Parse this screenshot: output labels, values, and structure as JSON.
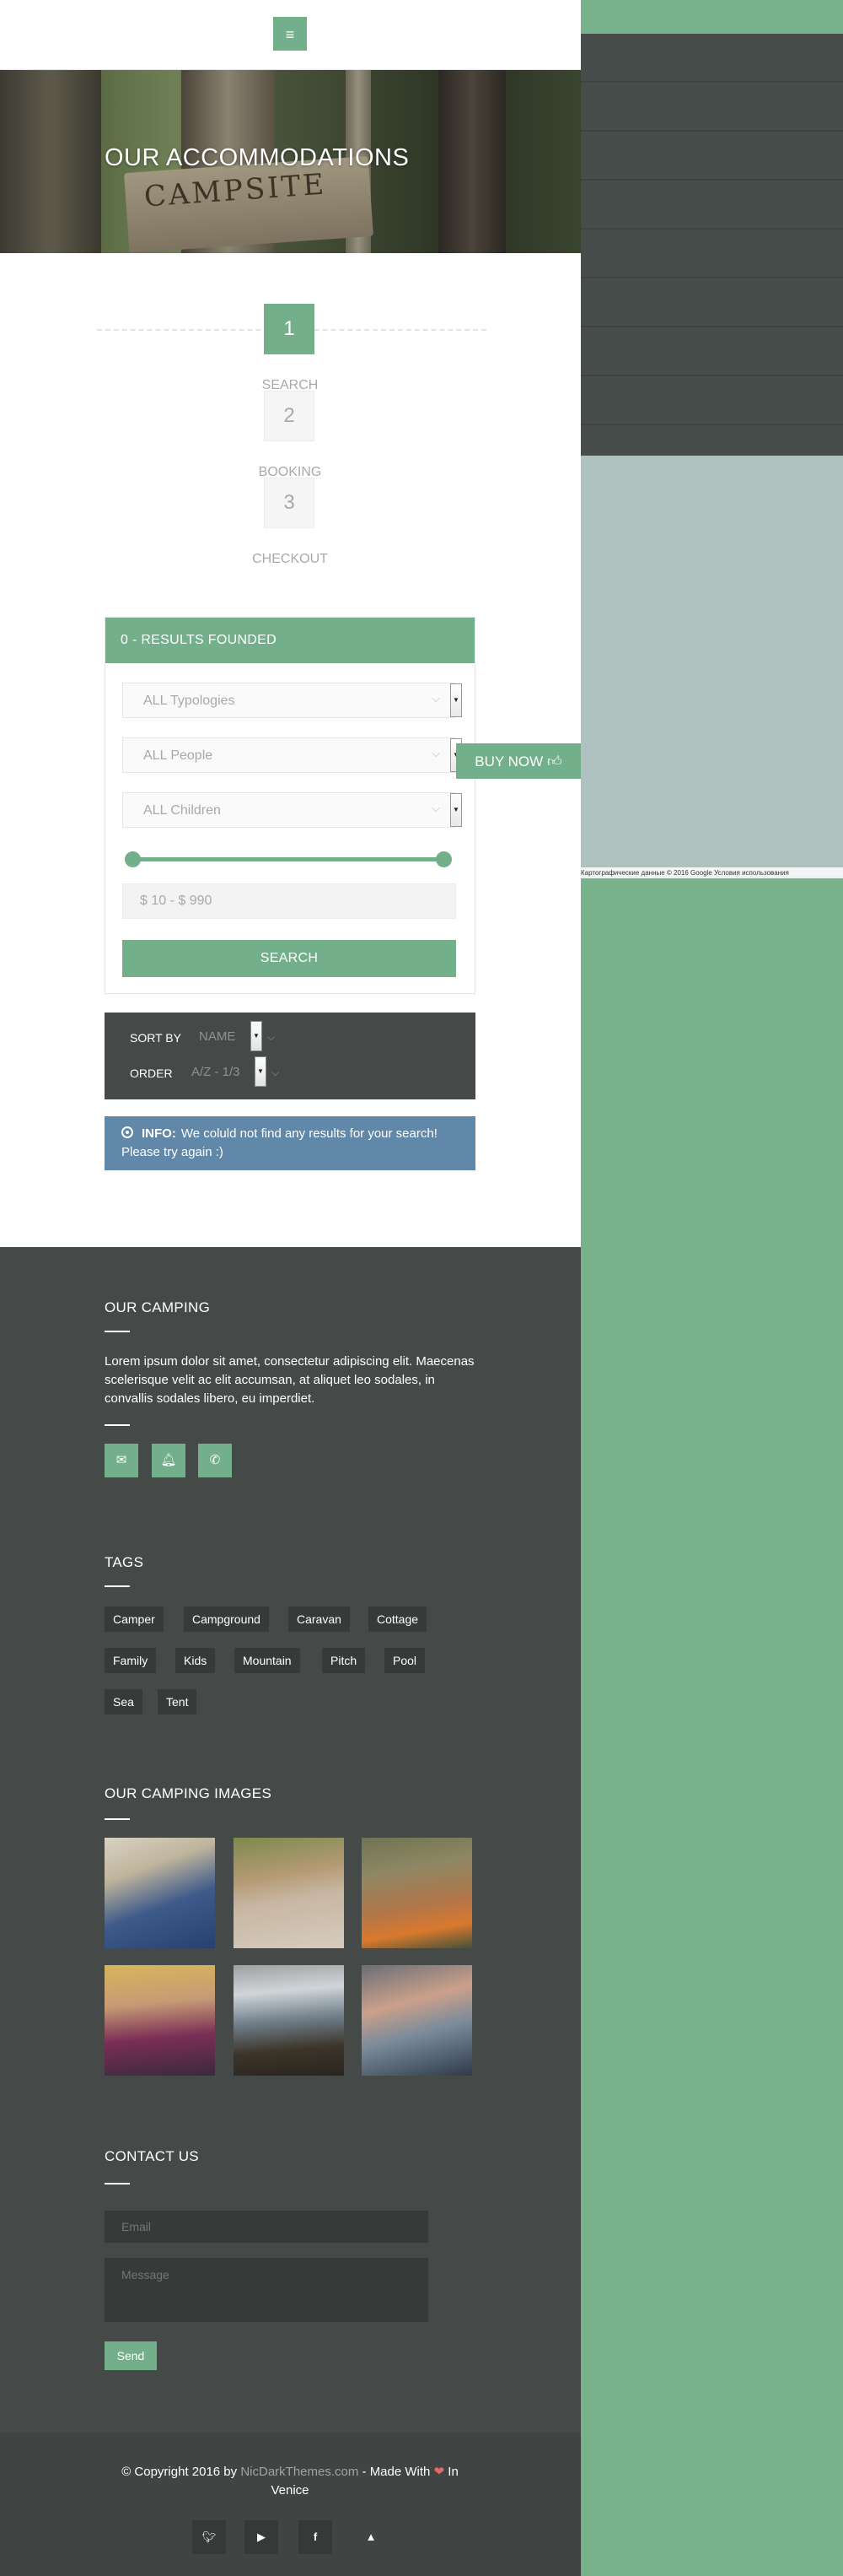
{
  "header": {
    "menu_icon": "≡"
  },
  "hero": {
    "title": "OUR ACCOMMODATIONS",
    "sign_text": "CAMPSITE"
  },
  "steps": [
    {
      "number": "1",
      "label": "SEARCH"
    },
    {
      "number": "2",
      "label": "BOOKING"
    },
    {
      "number": "3",
      "label": "CHECKOUT"
    }
  ],
  "results": {
    "title": "0 - RESULTS FOUNDED",
    "typology": "ALL Typologies",
    "people": "ALL People",
    "children": "ALL Children",
    "price_range": "$ 10 - $ 990",
    "search_label": "SEARCH"
  },
  "sort": {
    "sort_label": "SORT BY",
    "sort_value": "NAME",
    "order_label": "ORDER",
    "order_value": "A/Z - 1/3"
  },
  "info": {
    "label": "INFO:",
    "message": "We coluld not find any results for your search! Please try again :)"
  },
  "buy_now": "BUY NOW",
  "map_credit": "Картографические данные © 2016 Google   Условия использования",
  "footer": {
    "camping_title": "OUR CAMPING",
    "camping_text": "Lorem ipsum dolor sit amet, consectetur adipiscing elit. Maecenas scelerisque velit ac elit accumsan, at aliquet leo sodales, in convallis sodales libero, eu imperdiet.",
    "tags_title": "TAGS",
    "tags": [
      "Camper",
      "Campground",
      "Caravan",
      "Cottage",
      "Family",
      "Kids",
      "Mountain",
      "Pitch",
      "Pool",
      "Sea",
      "Tent"
    ],
    "images_title": "OUR CAMPING IMAGES",
    "contact_title": "CONTACT US",
    "email_placeholder": "Email",
    "message_placeholder": "Message",
    "send_label": "Send"
  },
  "bottom": {
    "copy_prefix": "© Copyright 2016 by ",
    "copy_link": "NicDarkThemes.com",
    "copy_mid": " - Made With ",
    "copy_suffix": " In Venice"
  },
  "colors": {
    "accent": "#74af8b",
    "dark": "#454a49",
    "info": "#6188a9"
  }
}
